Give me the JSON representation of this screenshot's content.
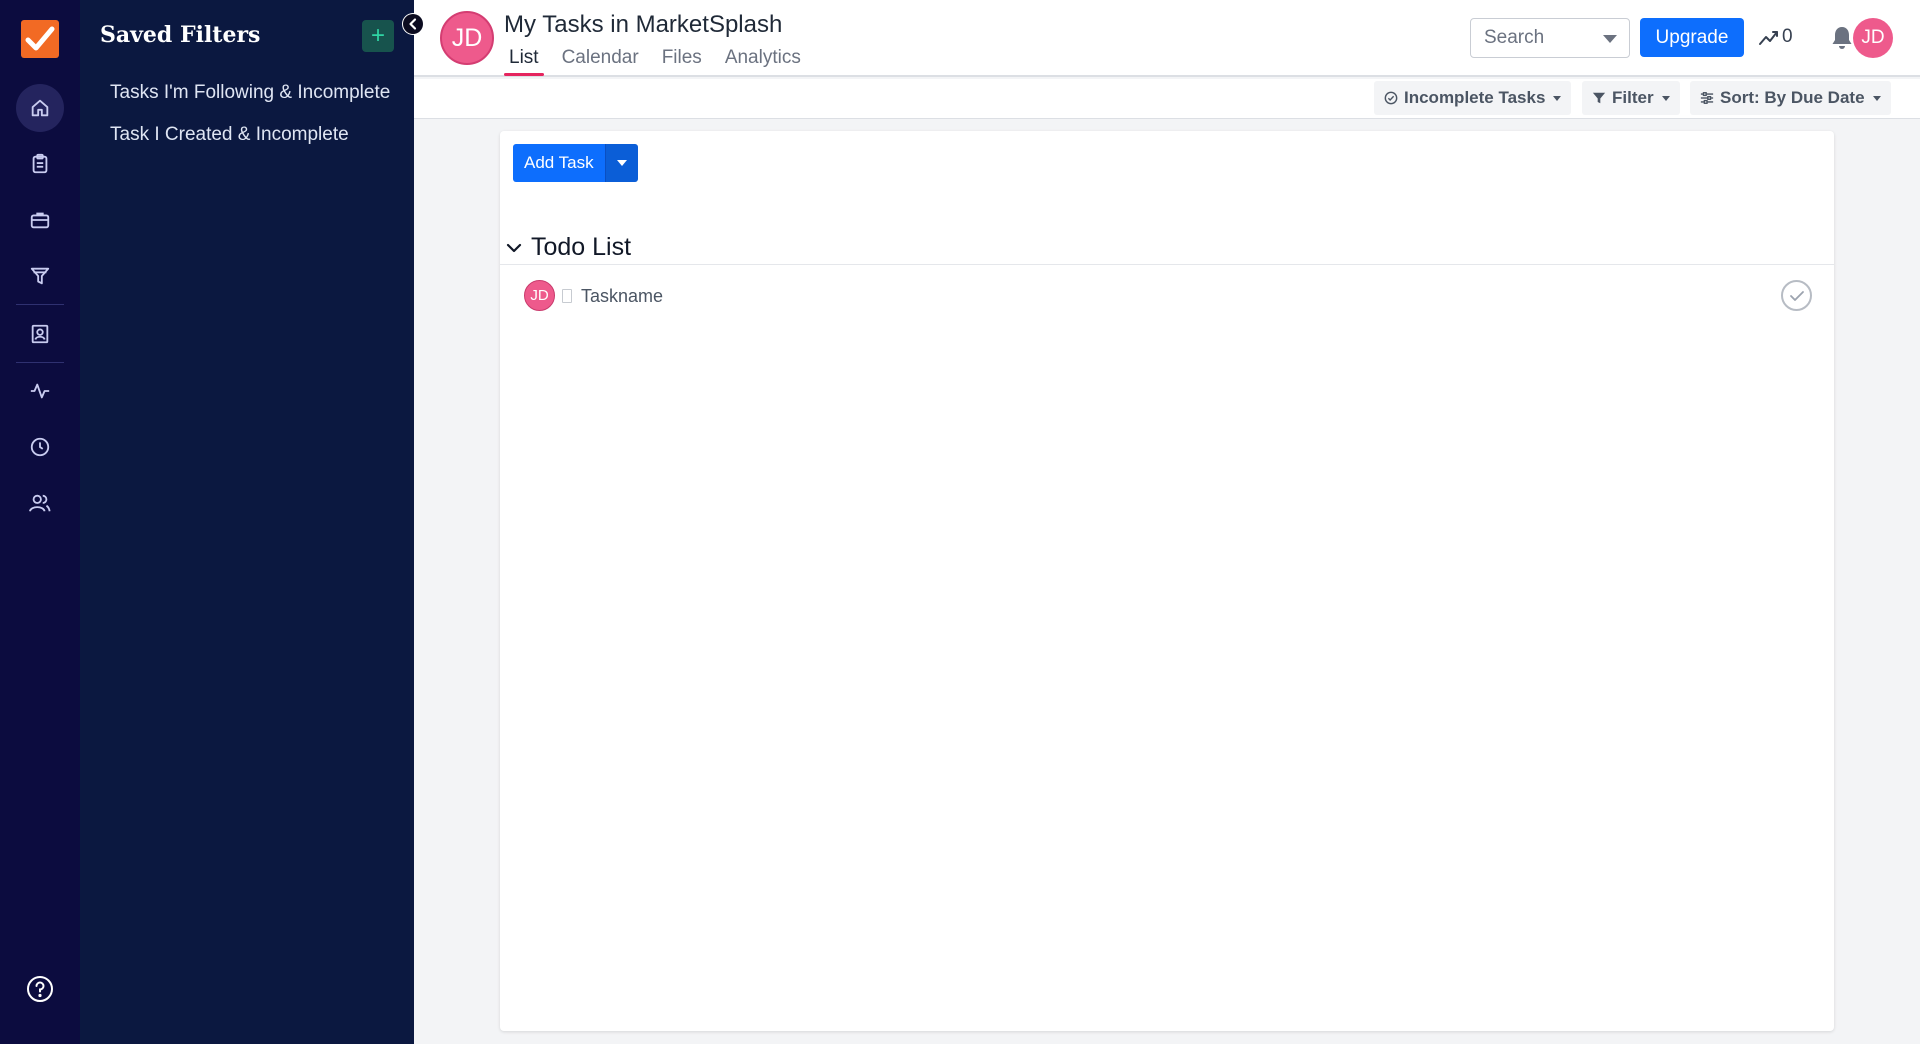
{
  "rail": {
    "icons": [
      "home-icon",
      "clipboard-icon",
      "briefcase-icon",
      "funnel-icon",
      "contacts-icon",
      "activity-icon",
      "clock-icon",
      "users-icon",
      "help-icon"
    ]
  },
  "panel": {
    "title": "Saved Filters",
    "add_label": "+",
    "items": [
      {
        "label": "Tasks I'm Following & Incomplete"
      },
      {
        "label": "Task I Created & Incomplete"
      }
    ]
  },
  "header": {
    "avatar_initials": "JD",
    "title": "My Tasks in MarketSplash",
    "tabs": [
      {
        "label": "List",
        "active": true
      },
      {
        "label": "Calendar",
        "active": false
      },
      {
        "label": "Files",
        "active": false
      },
      {
        "label": "Analytics",
        "active": false
      }
    ],
    "search_placeholder": "Search",
    "upgrade_label": "Upgrade",
    "activity_count": "0",
    "user_initials": "JD"
  },
  "toolbar": {
    "status_label": "Incomplete Tasks",
    "filter_label": "Filter",
    "sort_label": "Sort: By Due Date"
  },
  "content": {
    "add_task_label": "Add Task",
    "list_title": "Todo List",
    "tasks": [
      {
        "assignee_initials": "JD",
        "name": "Taskname"
      }
    ]
  },
  "colors": {
    "rail_bg": "#0c0c3f",
    "panel_bg": "#0b1840",
    "brand_orange": "#f26a24",
    "primary_blue": "#0d6efd",
    "avatar_pink": "#ee5a8c",
    "active_tab_underline": "#e5245e"
  }
}
